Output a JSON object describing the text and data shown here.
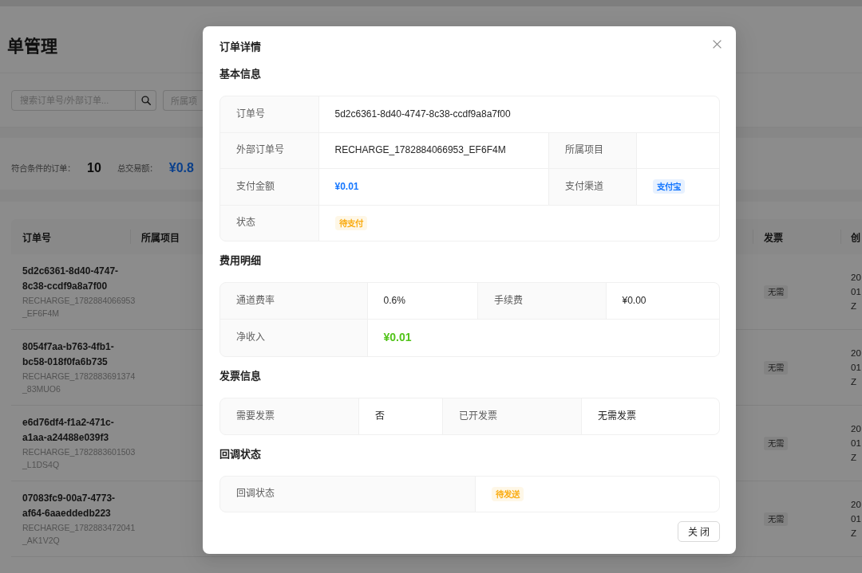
{
  "page": {
    "title": "单管理",
    "search": {
      "placeholder": "搜索订单号/外部订单..."
    },
    "filters": [
      {
        "placeholder": "所属项"
      }
    ],
    "summary": [
      {
        "kind": "count",
        "label": "符合条件的订单：",
        "value": "10"
      },
      {
        "kind": "amount",
        "label": "总交易额：",
        "value": "¥0.8"
      }
    ],
    "table": {
      "columns": [
        "订单号",
        "所属项目",
        "发票",
        "创"
      ],
      "rows": [
        {
          "order_no": "5d2c6361-8d40-4747-8c38-ccdf9a8a7f00",
          "external_no": "RECHARGE_1782884066953_EF6F4M",
          "invoice": "无需",
          "column_4": [
            "20",
            "01",
            "Z"
          ]
        },
        {
          "order_no": "8054f7aa-b763-4fb1-bc58-018f0fa6b735",
          "external_no": "RECHARGE_1782883691374_83MUO6",
          "invoice": "无需",
          "column_4": [
            "20",
            "01",
            "Z"
          ]
        },
        {
          "order_no": "e6d76df4-f1a2-471c-a1aa-a24488e039f3",
          "external_no": "RECHARGE_1782883601503_L1DS4Q",
          "invoice": "无需",
          "column_4": [
            "20",
            "01",
            "Z"
          ]
        },
        {
          "order_no": "07083fc9-00a7-4773-af64-6aaeddedb223",
          "external_no": "RECHARGE_1782883472041_AK1V2Q",
          "invoice": "无需",
          "column_4": [
            "20",
            "01",
            "Z"
          ]
        }
      ]
    }
  },
  "dialog": {
    "title": "订单详情",
    "sections": [
      {
        "title": "基本信息",
        "rows": [
          [
            {
              "label": "订单号",
              "value": {
                "kind": "text",
                "text": "5d2c6361-8d40-4747-8c38-ccdf9a8a7f00"
              }
            }
          ],
          [
            {
              "label": "外部订单号",
              "value": {
                "kind": "text",
                "text": "RECHARGE_1782884066953_EF6F4M"
              }
            },
            {
              "label": "所属项目"
            }
          ],
          [
            {
              "label": "支付金额",
              "value": {
                "kind": "amount",
                "text": "¥0.01",
                "color": "#1677ff"
              }
            },
            {
              "label": "支付渠道",
              "value": {
                "kind": "tag",
                "text": "支付宝",
                "color": "#1677ff"
              }
            }
          ],
          [
            {
              "label": "状态",
              "value": {
                "kind": "tag",
                "text": "待支付",
                "color": "#faad14"
              }
            }
          ]
        ]
      },
      {
        "title": "费用明细",
        "rows": [
          [
            {
              "label": "通道费率",
              "value": {
                "kind": "text",
                "text": "0.6%"
              }
            },
            {
              "label": "手续费",
              "value": {
                "kind": "text",
                "text": "¥0.00"
              }
            }
          ],
          [
            {
              "label": "净收入",
              "value": {
                "kind": "total",
                "text": "¥0.01",
                "color": "#52c41a"
              }
            }
          ]
        ]
      },
      {
        "title": "发票信息",
        "rows": [
          [
            {
              "label": "需要发票",
              "value": {
                "kind": "text",
                "text": "否"
              }
            },
            {
              "label": "已开发票",
              "value": {
                "kind": "text",
                "text": "无需发票"
              }
            }
          ]
        ]
      },
      {
        "title": "回调状态",
        "rows": [
          [
            {
              "label": "回调状态",
              "value": {
                "kind": "tag",
                "text": "待发送",
                "color": "#faad14"
              }
            }
          ]
        ]
      }
    ],
    "buttons": [
      "关 闭"
    ]
  }
}
